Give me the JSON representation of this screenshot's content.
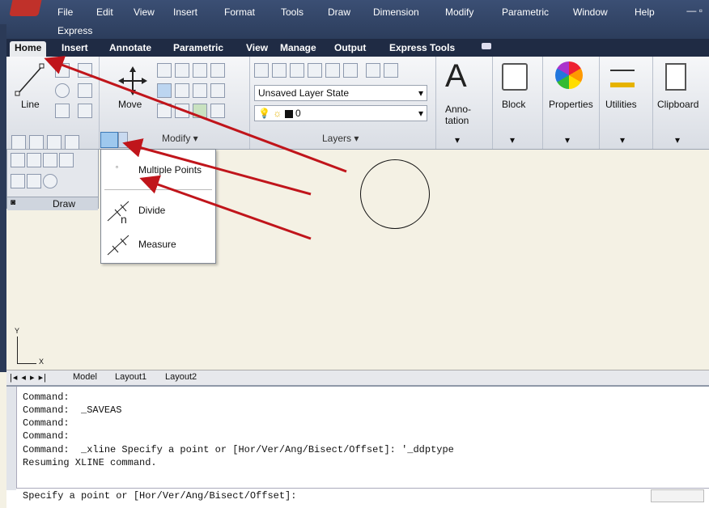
{
  "menu": {
    "items": [
      "File",
      "Edit",
      "View",
      "Insert",
      "Format",
      "Tools",
      "Draw",
      "Dimension",
      "Modify",
      "Parametric",
      "Window",
      "Help"
    ],
    "second_row": "Express"
  },
  "ribbon_tabs": [
    "Home",
    "Insert",
    "Annotate",
    "Parametric",
    "View",
    "Manage",
    "Output",
    "Express Tools"
  ],
  "draw_panel": {
    "line_label": "Line",
    "title": "Draw"
  },
  "modify_panel": {
    "move_label": "Move",
    "title": "Modify ▾"
  },
  "layers_panel": {
    "layer_state": "Unsaved Layer State",
    "layer_name": "0",
    "title": "Layers ▾"
  },
  "big_buttons": {
    "annotation_line1": "Anno-",
    "annotation_line2": "tation",
    "block": "Block",
    "properties": "Properties",
    "utilities": "Utilities",
    "clipboard": "Clipboard"
  },
  "dropdown": {
    "items": [
      {
        "label": "Multiple Points",
        "icon": "point-icon"
      },
      {
        "label": "Divide",
        "icon": "divide-icon"
      },
      {
        "label": "Measure",
        "icon": "measure-icon"
      }
    ]
  },
  "ucs": {
    "y": "Y",
    "x": "X"
  },
  "layout_tabs": [
    "Model",
    "Layout1",
    "Layout2"
  ],
  "command_history": [
    "Command:",
    "Command:  _SAVEAS",
    "Command:",
    "Command:",
    "Command:  _xline Specify a point or [Hor/Ver/Ang/Bisect/Offset]: '_ddptype",
    "Resuming XLINE command."
  ],
  "command_prompt": "Specify a point or [Hor/Ver/Ang/Bisect/Offset]:",
  "colors": {
    "arrow": "#c0151b",
    "menubar": "#2c3d5c",
    "canvas": "#f4f1e4"
  }
}
